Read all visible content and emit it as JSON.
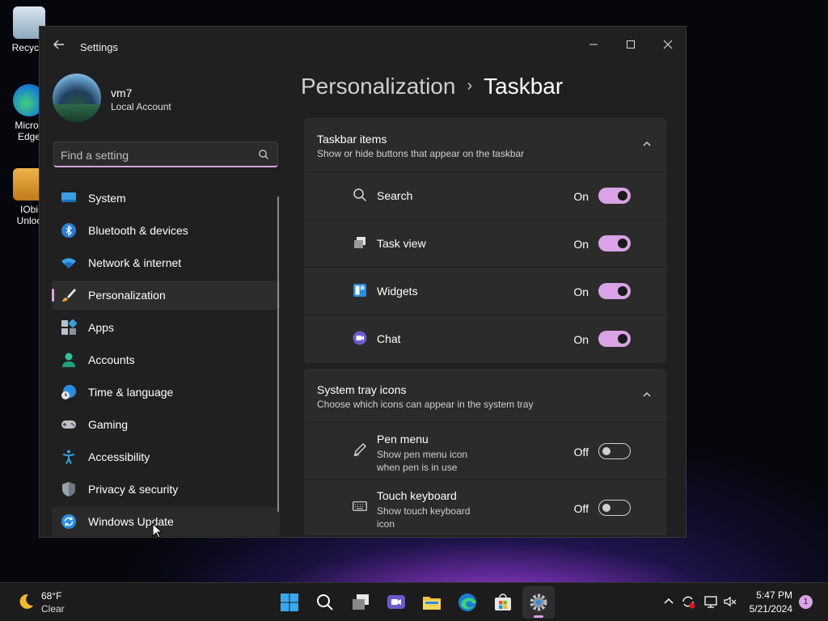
{
  "desktop": {
    "icons": [
      {
        "label": "Recycle"
      },
      {
        "label": "Micros\nEdge"
      },
      {
        "label": "IObi\nUnloc"
      }
    ]
  },
  "window": {
    "title": "Settings",
    "controls": {
      "minimize": "—",
      "maximize": "☐",
      "close": "✕"
    }
  },
  "user": {
    "name": "vm7",
    "account_type": "Local Account"
  },
  "search": {
    "placeholder": "Find a setting"
  },
  "sidebar": {
    "items": [
      {
        "label": "System",
        "icon": "system-icon"
      },
      {
        "label": "Bluetooth & devices",
        "icon": "bluetooth-icon"
      },
      {
        "label": "Network & internet",
        "icon": "wifi-icon"
      },
      {
        "label": "Personalization",
        "icon": "brush-icon",
        "active": true
      },
      {
        "label": "Apps",
        "icon": "apps-icon"
      },
      {
        "label": "Accounts",
        "icon": "accounts-icon"
      },
      {
        "label": "Time & language",
        "icon": "time-language-icon"
      },
      {
        "label": "Gaming",
        "icon": "gamepad-icon"
      },
      {
        "label": "Accessibility",
        "icon": "accessibility-icon"
      },
      {
        "label": "Privacy & security",
        "icon": "shield-icon"
      },
      {
        "label": "Windows Update",
        "icon": "update-icon"
      }
    ]
  },
  "breadcrumb": {
    "parent": "Personalization",
    "separator": "›",
    "current": "Taskbar"
  },
  "sections": [
    {
      "title": "Taskbar items",
      "description": "Show or hide buttons that appear on the taskbar",
      "rows": [
        {
          "label": "Search",
          "state": "On",
          "on": true,
          "icon": "search-icon"
        },
        {
          "label": "Task view",
          "state": "On",
          "on": true,
          "icon": "task-view-icon"
        },
        {
          "label": "Widgets",
          "state": "On",
          "on": true,
          "icon": "widgets-icon"
        },
        {
          "label": "Chat",
          "state": "On",
          "on": true,
          "icon": "chat-icon"
        }
      ]
    },
    {
      "title": "System tray icons",
      "description": "Choose which icons can appear in the system tray",
      "rows": [
        {
          "label": "Pen menu",
          "sub": "Show pen menu icon when pen is in use",
          "state": "Off",
          "on": false,
          "icon": "pen-icon"
        },
        {
          "label": "Touch keyboard",
          "sub": "Show touch keyboard icon",
          "state": "Off",
          "on": false,
          "icon": "keyboard-icon"
        }
      ]
    }
  ],
  "taskbar": {
    "weather": {
      "temp": "68°F",
      "condition": "Clear"
    },
    "clock": {
      "time": "5:47 PM",
      "date": "5/21/2024"
    },
    "notification_count": "1"
  },
  "colors": {
    "accent": "#d9a3e6",
    "window_bg": "#202020",
    "card_bg": "#2b2b2b"
  }
}
